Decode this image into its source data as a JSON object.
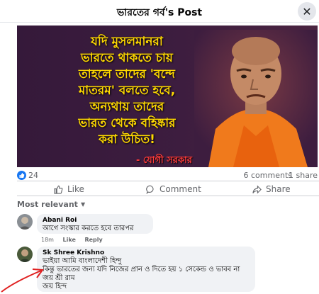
{
  "header": {
    "title": "ভারতের গর্ব's Post"
  },
  "post_image": {
    "lines": [
      "যদি মুসলমানরা",
      "ভারতে থাকতে চায়",
      "তাহলে তাদের 'বন্দে",
      "মাতরম' বলতে হবে,",
      "অন্যথায় তাদের",
      "ভারত থেকে বহিষ্কার",
      "করা উচিত!"
    ],
    "caption": "- যোগী সরকার"
  },
  "stats": {
    "likes": "24",
    "comments": "6 comments",
    "shares": "1 share"
  },
  "actions": {
    "like": "Like",
    "comment": "Comment",
    "share": "Share"
  },
  "sort": {
    "label": "Most relevant"
  },
  "comments": [
    {
      "name": "Abani Roi",
      "text": "আগে সংস্কার করতে হবে তারপর",
      "time": "18m",
      "like": "Like",
      "reply": "Reply"
    },
    {
      "name": "Sk Shree Krishno",
      "lines": [
        "ভাইয়া আমি বাংলাদেশী হিন্দু",
        "কিন্তু ভারতের জন্য যদি নিজের প্রান ও দিতে হয় ১ সেকেন্ড ও ভাবব না",
        "জয় শ্রী রাম",
        "জয় হিন্দ"
      ]
    }
  ],
  "colors": {
    "accent": "#1877f2",
    "image_bg": "#3b1e36",
    "image_text": "#ffd900",
    "caption": "#ff3b3b",
    "arrow": "#e02020"
  }
}
